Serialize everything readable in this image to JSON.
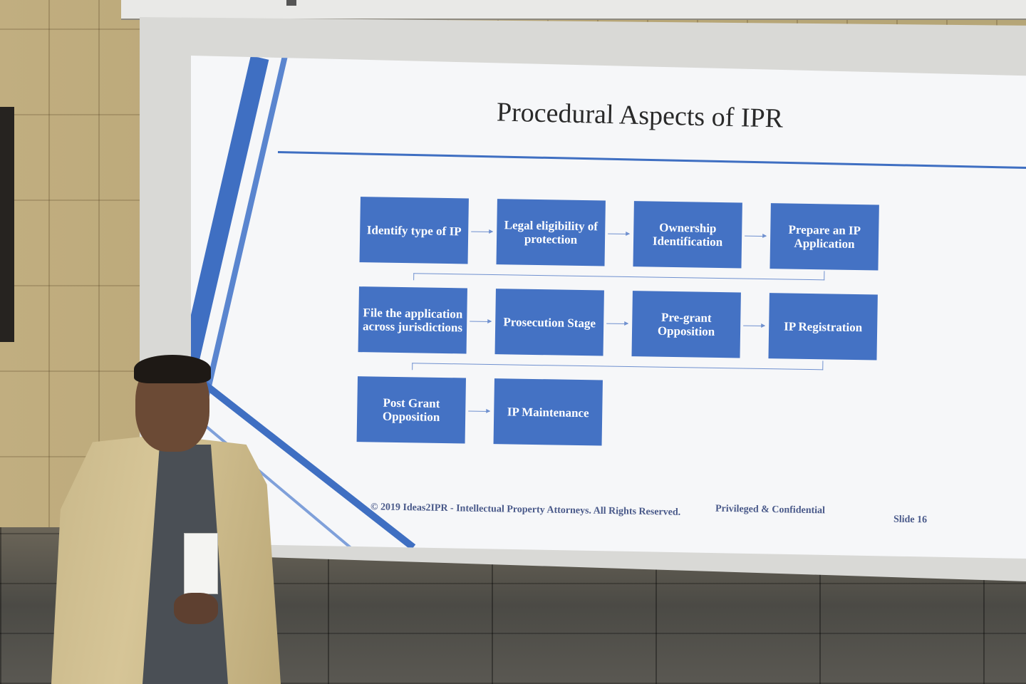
{
  "slide": {
    "title": "Procedural Aspects of IPR",
    "steps": [
      "Identify type of IP",
      "Legal eligibility of protection",
      "Ownership Identification",
      "Prepare an IP Application",
      "File the application across jurisdictions",
      "Prosecution Stage",
      "Pre-grant Opposition",
      "IP Registration",
      "Post Grant Opposition",
      "IP Maintenance"
    ],
    "footer": {
      "copyright": "© 2019 Ideas2IPR - Intellectual Property Attorneys. All Rights Reserved.",
      "confidential": "Privileged & Confidential",
      "slide_number": "Slide 16"
    }
  },
  "colors": {
    "box": "#4472c4",
    "accent": "#3f6fc2"
  }
}
